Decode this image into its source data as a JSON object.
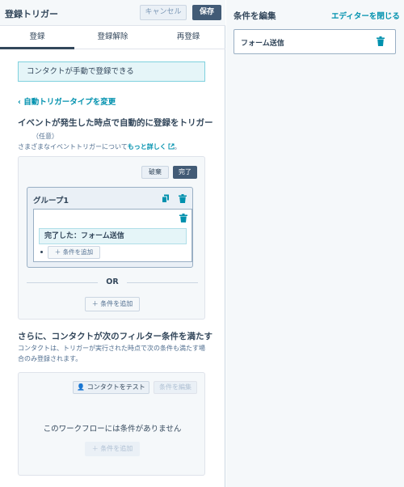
{
  "header": {
    "title": "登録トリガー",
    "cancel_label": "キャンセル",
    "save_label": "保存"
  },
  "tabs": [
    {
      "label": "登録",
      "active": true
    },
    {
      "label": "登録解除",
      "active": false
    },
    {
      "label": "再登録",
      "active": false
    }
  ],
  "info_box": "コンタクトが手動で登録できる",
  "back_link": "‹ 自動トリガータイプを変更",
  "trigger_section": {
    "heading": "イベントが発生した時点で自動的に登録をトリガー",
    "optional": "（任意）",
    "helper_prefix": "さまざまなイベントトリガーについて",
    "helper_link": "もっと詳しく",
    "helper_suffix": "。",
    "discard_label": "破棄",
    "done_label": "完了",
    "group": {
      "title": "グループ1",
      "condition": "完了した：フォーム送信",
      "add_condition_label": "条件を追加"
    },
    "or_label": "OR",
    "add_condition_label": "条件を追加"
  },
  "filter_section": {
    "heading": "さらに、コンタクトが次のフィルター条件を満たす",
    "description": "コンタクトは、トリガーが実行された時点で次の条件も満たす場合のみ登録されます。",
    "test_contact_label": "コンタクトをテスト",
    "edit_conditions_label": "条件を編集",
    "empty_text": "このワークフローには条件がありません",
    "add_condition_label": "条件を追加"
  },
  "right_panel": {
    "title": "条件を編集",
    "close_label": "エディターを閉じる",
    "card_label": "フォーム送信"
  },
  "colors": {
    "accent": "#0091ae",
    "primary_button": "#425b76",
    "text": "#33475b"
  }
}
